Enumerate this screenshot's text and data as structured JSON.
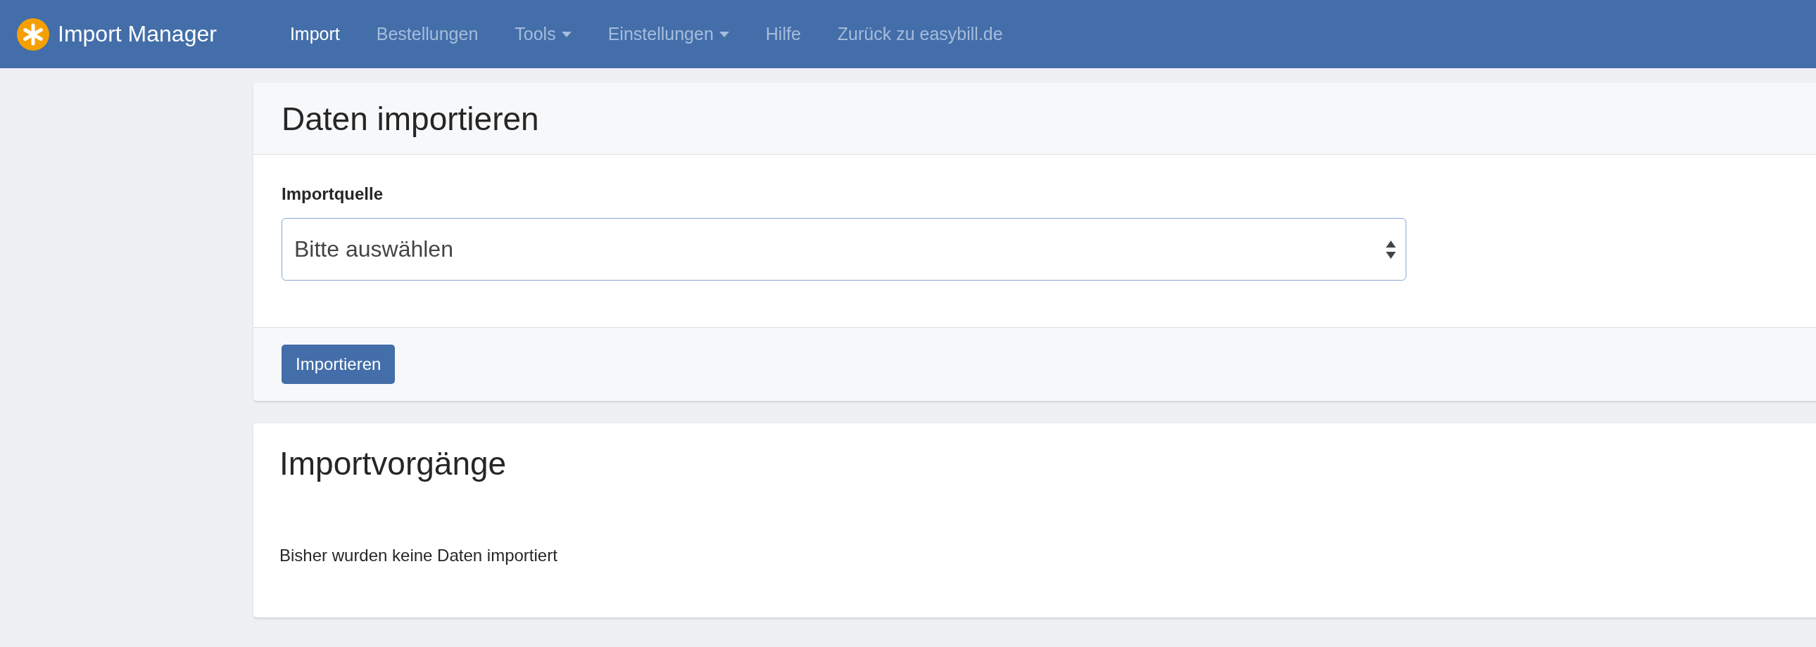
{
  "navbar": {
    "brand": "Import Manager",
    "items": [
      {
        "label": "Import",
        "selected": true,
        "dropdown": false
      },
      {
        "label": "Bestellungen",
        "selected": false,
        "dropdown": false
      },
      {
        "label": "Tools",
        "selected": false,
        "dropdown": true
      },
      {
        "label": "Einstellungen",
        "selected": false,
        "dropdown": true
      },
      {
        "label": "Hilfe",
        "selected": false,
        "dropdown": false
      },
      {
        "label": "Zurück zu easybill.de",
        "selected": false,
        "dropdown": false
      }
    ]
  },
  "import_panel": {
    "title": "Daten importieren",
    "field_label": "Importquelle",
    "select_value": "Bitte auswählen",
    "button": "Importieren"
  },
  "history_panel": {
    "title": "Importvorgänge",
    "empty_text": "Bisher wurden keine Daten importiert"
  }
}
